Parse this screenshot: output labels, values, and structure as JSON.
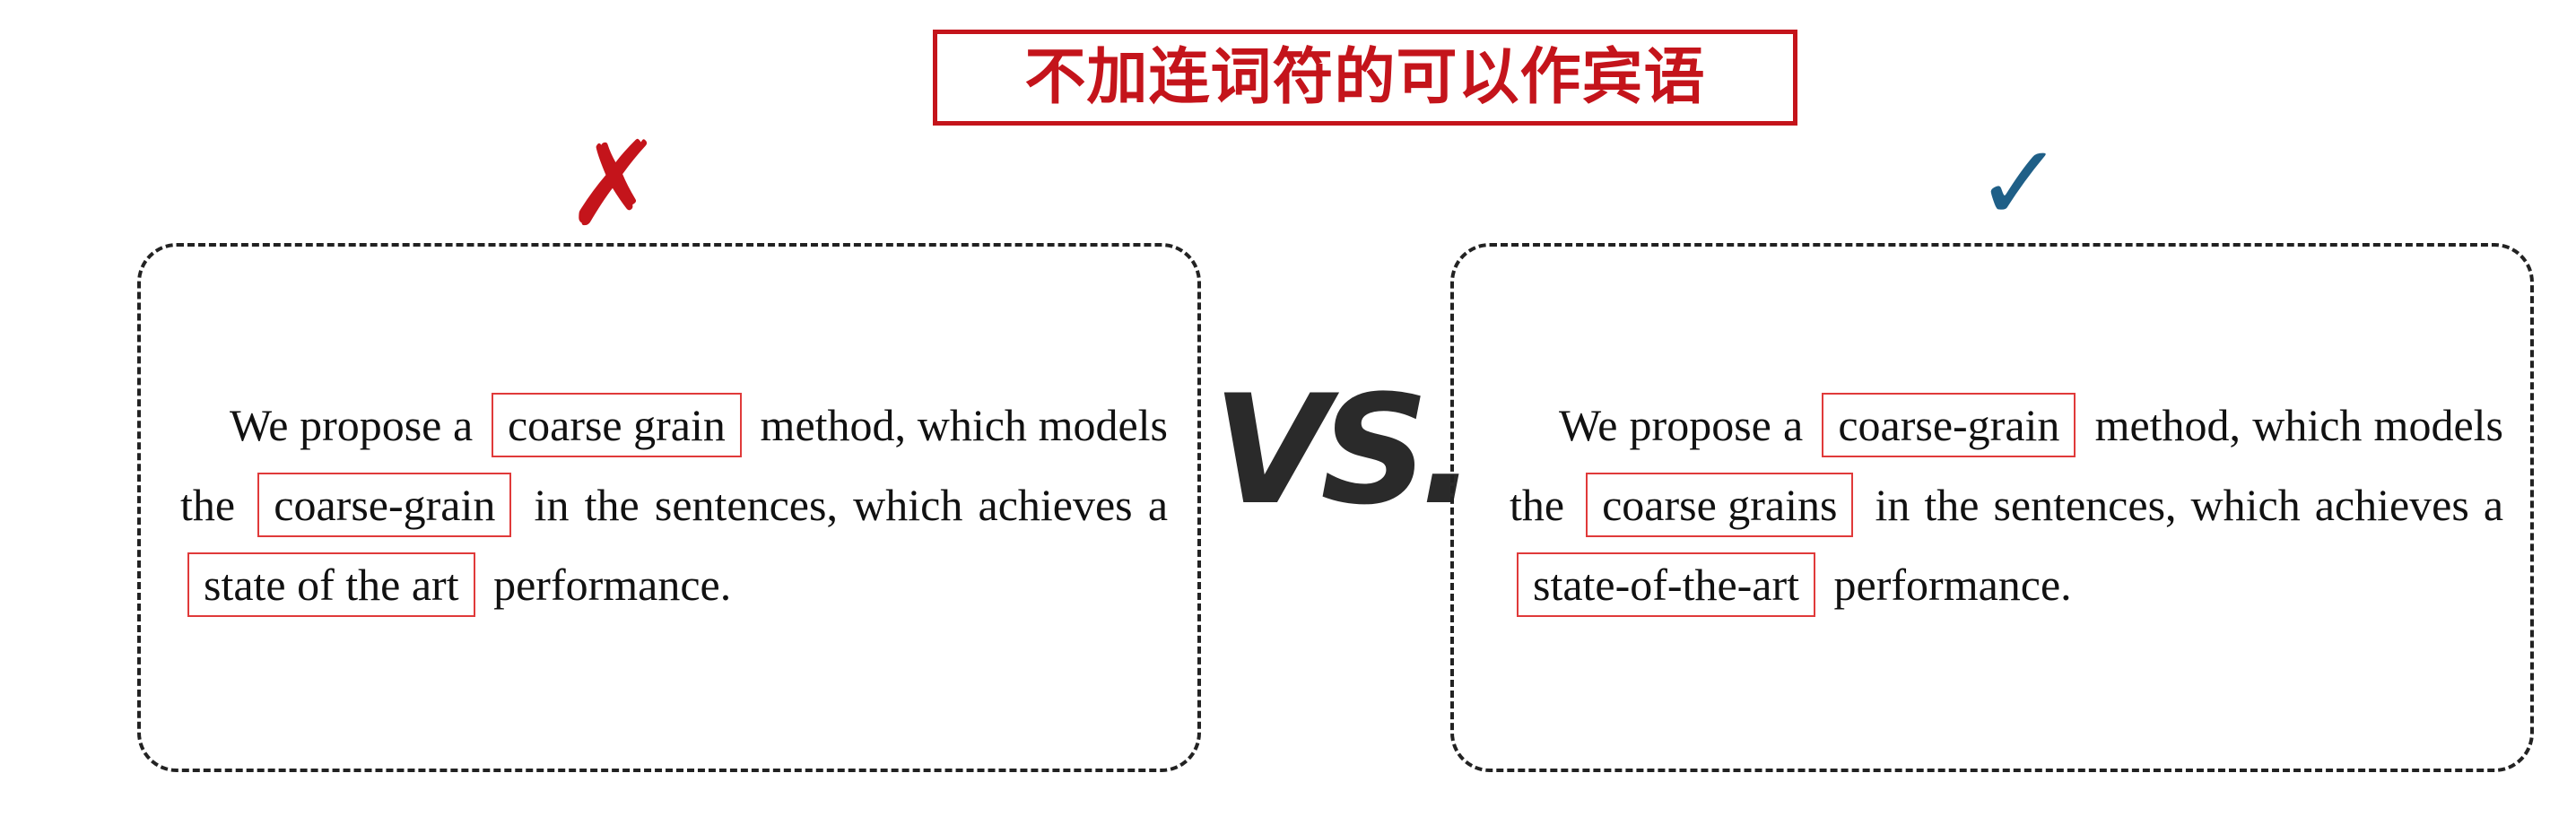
{
  "title": "不加连词符的可以作宾语",
  "marks": {
    "wrong_symbol": "✗",
    "right_symbol": "✓",
    "wrong_color": "#c4141b",
    "right_color": "#1f5f87"
  },
  "vs_label": "VS.",
  "wrong_example": {
    "t1": "We propose a",
    "h1": "coarse grain",
    "t2": "method, which models the",
    "h2": "coarse-grain",
    "t3": "in the sentences, which achieves a",
    "h3": "state of the art",
    "t4": "performance."
  },
  "correct_example": {
    "t1": "We propose a",
    "h1": "coarse-grain",
    "t2": "method, which models the",
    "h2": "coarse grains",
    "t3": "in the sentences, which achieves a",
    "h3": "state-of-the-art",
    "t4": "performance."
  },
  "colors": {
    "accent_red": "#c4141b",
    "highlight_border": "#e03a3a",
    "check_blue": "#1f5f87"
  }
}
